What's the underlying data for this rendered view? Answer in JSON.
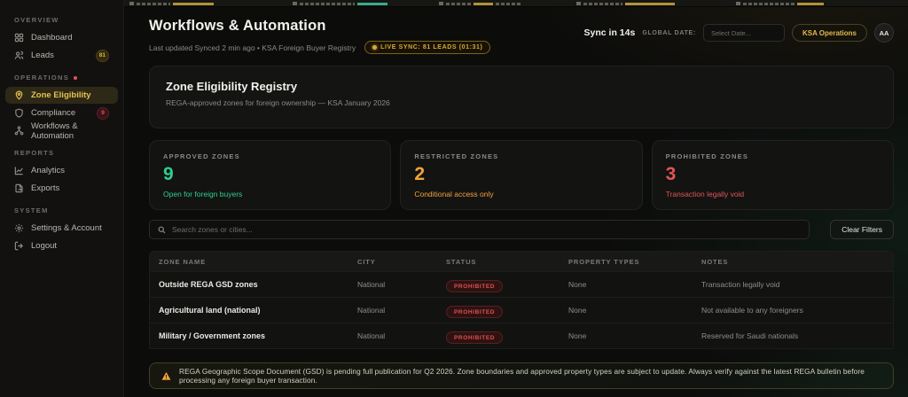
{
  "sidebar": {
    "sections": [
      {
        "label": "OVERVIEW",
        "items": [
          {
            "label": "Dashboard",
            "icon": "dashboard-grid-icon"
          },
          {
            "label": "Leads",
            "icon": "users-icon",
            "badge": "81"
          }
        ]
      },
      {
        "label": "OPERATIONS",
        "has_alert_dot": true,
        "items": [
          {
            "label": "Zone Eligibility",
            "icon": "map-pin-icon",
            "active": true
          },
          {
            "label": "Compliance",
            "icon": "shield-icon",
            "badge": "9"
          },
          {
            "label": "Workflows & Automation",
            "icon": "workflow-icon"
          }
        ]
      },
      {
        "label": "REPORTS",
        "items": [
          {
            "label": "Analytics",
            "icon": "analytics-chart-icon"
          },
          {
            "label": "Exports",
            "icon": "export-file-icon"
          }
        ]
      },
      {
        "label": "SYSTEM",
        "items": [
          {
            "label": "Settings & Account",
            "icon": "gear-icon"
          },
          {
            "label": "Logout",
            "icon": "logout-icon"
          }
        ]
      }
    ]
  },
  "header": {
    "title": "Workflows & Automation",
    "subtitle": "Last updated Synced 2 min ago • KSA Foreign Buyer Registry",
    "live_badge": "LIVE SYNC: 81 LEADS (01:31)",
    "sync_countdown": "Sync in 14s",
    "global_date_label": "GLOBAL DATE:",
    "date_placeholder": "Select Date...",
    "org_button": "KSA Operations",
    "avatar_initials": "AA"
  },
  "registry": {
    "title": "Zone Eligibility Registry",
    "subtitle": "REGA-approved zones for foreign ownership — KSA January 2026"
  },
  "stats": [
    {
      "label": "APPROVED ZONES",
      "value": "9",
      "caption": "Open for foreign buyers",
      "color": "#2fcf8e"
    },
    {
      "label": "RESTRICTED ZONES",
      "value": "2",
      "caption": "Conditional access only",
      "color": "#f2a33c"
    },
    {
      "label": "PROHIBITED ZONES",
      "value": "3",
      "caption": "Transaction legally void",
      "color": "#e25555"
    }
  ],
  "filters": {
    "search_placeholder": "Search zones or cities...",
    "clear_button": "Clear Filters"
  },
  "table": {
    "columns": [
      "ZONE NAME",
      "CITY",
      "STATUS",
      "PROPERTY TYPES",
      "NOTES"
    ],
    "rows": [
      {
        "zone": "Outside REGA GSD zones",
        "city": "National",
        "status": "PROHIBITED",
        "property_types": "None",
        "notes": "Transaction legally void"
      },
      {
        "zone": "Agricultural land (national)",
        "city": "National",
        "status": "PROHIBITED",
        "property_types": "None",
        "notes": "Not available to any foreigners"
      },
      {
        "zone": "Military / Government zones",
        "city": "National",
        "status": "PROHIBITED",
        "property_types": "None",
        "notes": "Reserved for Saudi nationals"
      }
    ]
  },
  "banner": {
    "text": "REGA Geographic Scope Document (GSD) is pending full publication for Q2 2026. Zone boundaries and approved property types are subject to update. Always verify against the latest REGA bulletin before processing any foreign buyer transaction."
  },
  "colors": {
    "accent_gold": "#e6c254",
    "status_prohibited": "#e05050",
    "approved_green": "#2fcf8e",
    "restricted_orange": "#f2a33c"
  }
}
